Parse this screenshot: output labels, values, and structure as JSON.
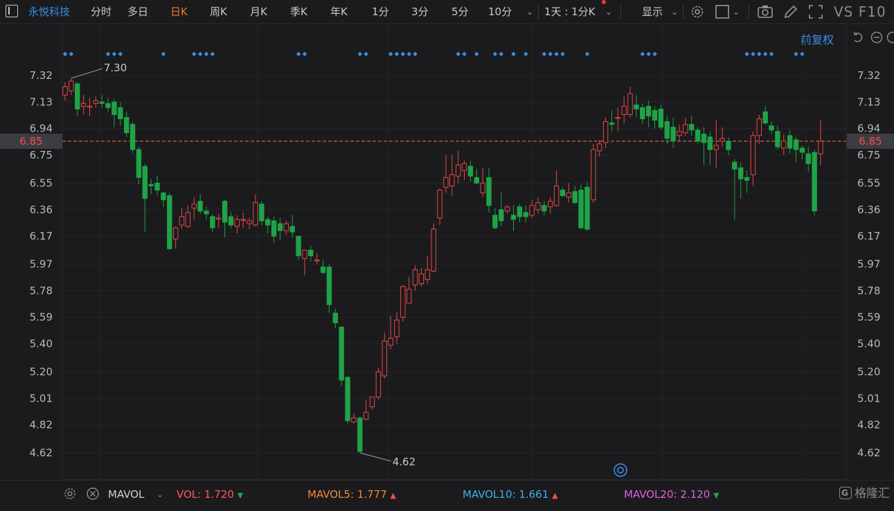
{
  "toolbar": {
    "stock_name": "永悦科技",
    "periods": [
      "分时",
      "多日",
      "日K",
      "周K",
      "月K",
      "季K",
      "年K",
      "1分",
      "3分",
      "5分",
      "10分"
    ],
    "active_period": "日K",
    "range_select": "1天 : 1分K",
    "display": "显示",
    "vs_f10": "VS F10"
  },
  "adjust": "前复权",
  "price_axis": {
    "ticks": [
      "7.32",
      "7.13",
      "6.94",
      "6.75",
      "6.55",
      "6.36",
      "6.17",
      "5.97",
      "5.78",
      "5.59",
      "5.40",
      "5.20",
      "5.01",
      "4.82",
      "4.62"
    ],
    "current": "6.85",
    "high_label": "7.30",
    "low_label": "4.62"
  },
  "colors": {
    "up": "#e84848",
    "down": "#1fa347",
    "current_line": "#ff7a3a",
    "signal": "#3d8ee8",
    "vol": "#ff5a5a",
    "mavol5": "#f0883a",
    "mavol10": "#3db0e8",
    "mavol20": "#e060e0"
  },
  "chart_data": {
    "type": "candlestick",
    "y_range": [
      4.62,
      7.32
    ],
    "candles": [
      [
        7.18,
        7.24,
        7.27,
        7.14
      ],
      [
        7.21,
        7.28,
        7.3,
        7.18
      ],
      [
        7.26,
        7.08,
        7.27,
        7.03
      ],
      [
        7.1,
        7.12,
        7.18,
        7.04
      ],
      [
        7.1,
        7.1,
        7.16,
        7.03
      ],
      [
        7.12,
        7.14,
        7.17,
        7.09
      ],
      [
        7.13,
        7.12,
        7.18,
        7.09
      ],
      [
        7.12,
        7.09,
        7.16,
        7.06
      ],
      [
        7.13,
        7.04,
        7.15,
        6.95
      ],
      [
        7.09,
        7.01,
        7.13,
        6.96
      ],
      [
        7.02,
        6.91,
        7.06,
        6.88
      ],
      [
        6.97,
        6.79,
        6.99,
        6.76
      ],
      [
        6.79,
        6.59,
        6.81,
        6.54
      ],
      [
        6.67,
        6.44,
        6.69,
        6.2
      ],
      [
        6.54,
        6.53,
        6.58,
        6.47
      ],
      [
        6.55,
        6.5,
        6.6,
        6.46
      ],
      [
        6.48,
        6.43,
        6.49,
        6.38
      ],
      [
        6.46,
        6.08,
        6.48,
        6.07
      ],
      [
        6.15,
        6.23,
        6.24,
        6.08
      ],
      [
        6.25,
        6.31,
        6.37,
        6.22
      ],
      [
        6.24,
        6.34,
        6.39,
        6.23
      ],
      [
        6.37,
        6.4,
        6.45,
        6.29
      ],
      [
        6.42,
        6.35,
        6.47,
        6.33
      ],
      [
        6.35,
        6.33,
        6.38,
        6.29
      ],
      [
        6.31,
        6.23,
        6.33,
        6.2
      ],
      [
        6.3,
        6.3,
        6.33,
        6.23
      ],
      [
        6.42,
        6.27,
        6.43,
        6.16
      ],
      [
        6.31,
        6.25,
        6.34,
        6.23
      ],
      [
        6.24,
        6.29,
        6.32,
        6.19
      ],
      [
        6.29,
        6.29,
        6.34,
        6.23
      ],
      [
        6.26,
        6.28,
        6.3,
        6.22
      ],
      [
        6.25,
        6.41,
        6.47,
        6.24
      ],
      [
        6.4,
        6.28,
        6.42,
        6.25
      ],
      [
        6.29,
        6.25,
        6.31,
        6.19
      ],
      [
        6.28,
        6.17,
        6.31,
        6.12
      ],
      [
        6.26,
        6.21,
        6.3,
        6.14
      ],
      [
        6.21,
        6.26,
        6.28,
        6.18
      ],
      [
        6.24,
        6.2,
        6.32,
        6.16
      ],
      [
        6.17,
        6.03,
        6.17,
        6.0
      ],
      [
        6.01,
        6.07,
        6.07,
        5.89
      ],
      [
        6.07,
        6.03,
        6.1,
        5.99
      ],
      [
        6.0,
        6.0,
        6.05,
        5.97
      ],
      [
        5.95,
        5.91,
        6.0,
        5.9
      ],
      [
        5.95,
        5.68,
        5.97,
        5.62
      ],
      [
        5.62,
        5.55,
        5.65,
        5.51
      ],
      [
        5.52,
        5.14,
        5.52,
        5.1
      ],
      [
        5.16,
        4.85,
        5.17,
        4.83
      ],
      [
        4.84,
        4.87,
        4.9,
        4.83
      ],
      [
        4.87,
        4.63,
        4.88,
        4.62
      ],
      [
        4.86,
        4.91,
        5.0,
        4.88
      ],
      [
        4.95,
        5.02,
        5.02,
        4.93
      ],
      [
        5.02,
        5.2,
        5.23,
        5.0
      ],
      [
        5.17,
        5.42,
        5.48,
        5.15
      ],
      [
        5.39,
        5.44,
        5.6,
        5.36
      ],
      [
        5.45,
        5.57,
        5.63,
        5.4
      ],
      [
        5.59,
        5.81,
        5.82,
        5.56
      ],
      [
        5.69,
        5.79,
        5.88,
        5.73
      ],
      [
        5.82,
        5.93,
        5.96,
        5.78
      ],
      [
        5.83,
        5.9,
        5.94,
        5.81
      ],
      [
        5.86,
        5.93,
        6.03,
        5.83
      ],
      [
        5.92,
        6.22,
        6.26,
        5.91
      ],
      [
        6.3,
        6.5,
        6.51,
        6.25
      ],
      [
        6.52,
        6.59,
        6.75,
        6.48
      ],
      [
        6.53,
        6.61,
        6.75,
        6.46
      ],
      [
        6.6,
        6.68,
        6.78,
        6.55
      ],
      [
        6.64,
        6.69,
        6.71,
        6.57
      ],
      [
        6.67,
        6.6,
        6.71,
        6.56
      ],
      [
        6.59,
        6.55,
        6.65,
        6.54
      ],
      [
        6.48,
        6.55,
        6.66,
        6.45
      ],
      [
        6.59,
        6.39,
        6.66,
        6.34
      ],
      [
        6.32,
        6.23,
        6.37,
        6.22
      ],
      [
        6.36,
        6.28,
        6.49,
        6.24
      ],
      [
        6.35,
        6.38,
        6.39,
        6.33
      ],
      [
        6.32,
        6.29,
        6.39,
        6.21
      ],
      [
        6.38,
        6.31,
        6.4,
        6.27
      ],
      [
        6.34,
        6.31,
        6.39,
        6.27
      ],
      [
        6.32,
        6.39,
        6.43,
        6.3
      ],
      [
        6.36,
        6.41,
        6.45,
        6.33
      ],
      [
        6.39,
        6.35,
        6.42,
        6.32
      ],
      [
        6.38,
        6.42,
        6.45,
        6.33
      ],
      [
        6.39,
        6.53,
        6.64,
        6.38
      ],
      [
        6.5,
        6.46,
        6.52,
        6.45
      ],
      [
        6.45,
        6.48,
        6.55,
        6.41
      ],
      [
        6.49,
        6.41,
        6.53,
        6.4
      ],
      [
        6.5,
        6.23,
        6.54,
        6.22
      ],
      [
        6.52,
        6.22,
        6.56,
        6.21
      ],
      [
        6.43,
        6.79,
        6.83,
        6.41
      ],
      [
        6.78,
        6.83,
        6.86,
        6.74
      ],
      [
        6.84,
        6.99,
        7.02,
        6.8
      ],
      [
        6.98,
        6.97,
        7.07,
        6.92
      ],
      [
        7.02,
        7.02,
        7.09,
        6.92
      ],
      [
        7.04,
        7.1,
        7.17,
        6.98
      ],
      [
        7.04,
        7.19,
        7.24,
        7.02
      ],
      [
        7.11,
        7.08,
        7.18,
        7.02
      ],
      [
        7.09,
        7.01,
        7.12,
        6.97
      ],
      [
        7.1,
        7.03,
        7.14,
        6.95
      ],
      [
        7.07,
        7.0,
        7.1,
        6.94
      ],
      [
        7.08,
        6.95,
        7.11,
        6.93
      ],
      [
        6.99,
        6.87,
        7.03,
        6.83
      ],
      [
        6.95,
        6.85,
        7.02,
        6.8
      ],
      [
        6.89,
        6.92,
        6.97,
        6.85
      ],
      [
        6.91,
        6.97,
        7.02,
        6.89
      ],
      [
        6.97,
        6.93,
        7.03,
        6.89
      ],
      [
        6.93,
        6.85,
        6.95,
        6.83
      ],
      [
        6.9,
        6.84,
        6.95,
        6.68
      ],
      [
        6.88,
        6.79,
        6.92,
        6.68
      ],
      [
        6.79,
        6.82,
        7.0,
        6.66
      ],
      [
        6.85,
        6.87,
        6.95,
        6.81
      ],
      [
        6.85,
        6.79,
        6.88,
        6.75
      ],
      [
        6.7,
        6.65,
        6.72,
        6.29
      ],
      [
        6.66,
        6.58,
        6.7,
        6.44
      ],
      [
        6.59,
        6.57,
        6.64,
        6.48
      ],
      [
        6.61,
        6.89,
        6.92,
        6.53
      ],
      [
        6.89,
        7.01,
        7.04,
        6.83
      ],
      [
        7.06,
        6.98,
        7.1,
        6.97
      ],
      [
        6.96,
        6.93,
        6.99,
        6.9
      ],
      [
        6.92,
        6.81,
        6.96,
        6.79
      ],
      [
        6.8,
        6.85,
        6.9,
        6.75
      ],
      [
        6.89,
        6.8,
        6.93,
        6.76
      ],
      [
        6.86,
        6.79,
        6.88,
        6.7
      ],
      [
        6.8,
        6.77,
        6.82,
        6.72
      ],
      [
        6.76,
        6.69,
        6.81,
        6.63
      ],
      [
        6.77,
        6.35,
        6.79,
        6.32
      ],
      [
        6.76,
        6.85,
        7.0,
        6.68
      ]
    ],
    "signal_marker_count": 41
  },
  "bottom": {
    "indicator": "MAVOL",
    "vol_label": "VOL:",
    "vol_value": "1.720",
    "mavol5_label": "MAVOL5:",
    "mavol5_value": "1.777",
    "mavol10_label": "MAVOL10:",
    "mavol10_value": "1.661",
    "mavol20_label": "MAVOL20:",
    "mavol20_value": "2.120",
    "logo": "格隆汇"
  }
}
